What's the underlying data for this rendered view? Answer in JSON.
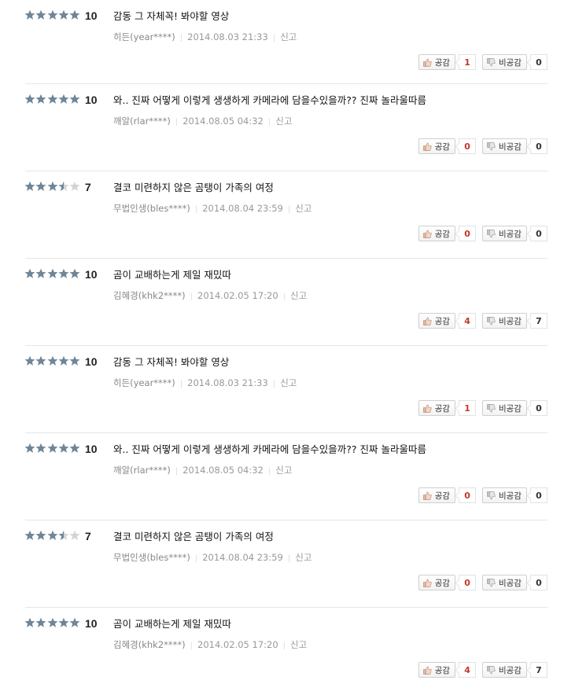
{
  "labels": {
    "like": "공감",
    "dislike": "비공감",
    "report": "신고"
  },
  "colors": {
    "star_filled": "#6f8699",
    "star_empty": "#d4d4d4",
    "like_count": "#c0392b"
  },
  "reviews": [
    {
      "stars": 5,
      "score": "10",
      "comment": "감동 그 자체꼭! 봐야할 영상",
      "user": "히든(year****)",
      "date": "2014.08.03 21:33",
      "likes": "1",
      "dislikes": "0"
    },
    {
      "stars": 5,
      "score": "10",
      "comment": "와.. 진짜 어떻게 이렇게 생생하게 카메라에 담을수있을까?? 진짜 놀라울따름",
      "user": "깨알(rlar****)",
      "date": "2014.08.05 04:32",
      "likes": "0",
      "dislikes": "0"
    },
    {
      "stars": 3.5,
      "score": "7",
      "comment": "결코 미련하지 않은 곰탱이 가족의 여정",
      "user": "무법인생(bles****)",
      "date": "2014.08.04 23:59",
      "likes": "0",
      "dislikes": "0"
    },
    {
      "stars": 5,
      "score": "10",
      "comment": "곰이 교배하는게 제일 재밌따",
      "user": "김혜경(khk2****)",
      "date": "2014.02.05 17:20",
      "likes": "4",
      "dislikes": "7"
    },
    {
      "stars": 5,
      "score": "10",
      "comment": "감동 그 자체꼭! 봐야할 영상",
      "user": "히든(year****)",
      "date": "2014.08.03 21:33",
      "likes": "1",
      "dislikes": "0"
    },
    {
      "stars": 5,
      "score": "10",
      "comment": "와.. 진짜 어떻게 이렇게 생생하게 카메라에 담을수있을까?? 진짜 놀라울따름",
      "user": "깨알(rlar****)",
      "date": "2014.08.05 04:32",
      "likes": "0",
      "dislikes": "0"
    },
    {
      "stars": 3.5,
      "score": "7",
      "comment": "결코 미련하지 않은 곰탱이 가족의 여정",
      "user": "무법인생(bles****)",
      "date": "2014.08.04 23:59",
      "likes": "0",
      "dislikes": "0"
    },
    {
      "stars": 5,
      "score": "10",
      "comment": "곰이 교배하는게 제일 재밌따",
      "user": "김혜경(khk2****)",
      "date": "2014.02.05 17:20",
      "likes": "4",
      "dislikes": "7"
    }
  ]
}
